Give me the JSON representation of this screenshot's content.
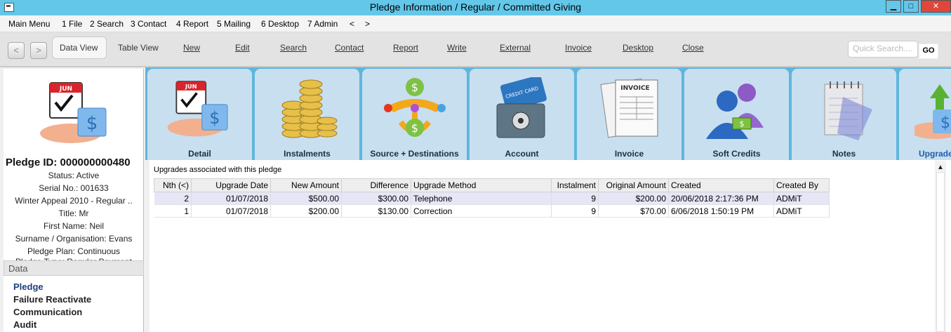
{
  "window": {
    "title": "Pledge Information / Regular / Committed Giving",
    "minimize": "▁",
    "maximize": "□",
    "close": "✕"
  },
  "menu": [
    "Main Menu",
    "1 File",
    "2 Search",
    "3 Contact",
    "4 Report",
    "5 Mailing",
    "6 Desktop",
    "7 Admin",
    "<",
    ">"
  ],
  "toolbar": {
    "back": "<",
    "forward": ">",
    "items": [
      "Data View",
      "Table View",
      "New",
      "Edit",
      "Search",
      "Contact",
      "Report",
      "Write",
      "External",
      "Invoice",
      "Desktop",
      "Close"
    ],
    "quick_search_placeholder": "Quick Search....",
    "go": "GO"
  },
  "record": {
    "pledge_id": "Pledge ID: 000000000480",
    "lines": [
      "Status: Active",
      "Serial No.: 001633",
      "Winter Appeal 2010 - Regular ..",
      "Title: Mr",
      "First Name: Neil",
      "Surname / Organisation: Evans",
      "Pledge Plan: Continuous",
      "Pledge Type: Regular Payment"
    ]
  },
  "data_panel": {
    "header": "Data",
    "links": [
      "Pledge",
      "Failure Reactivate",
      "Communication",
      "Audit"
    ]
  },
  "tabs": [
    "Detail",
    "Instalments",
    "Source + Destinations",
    "Account",
    "Invoice",
    "Soft Credits",
    "Notes",
    "Upgrades"
  ],
  "calendar_month": "JUN",
  "invoice_text": "INVOICE",
  "card_text": "CREDIT CARD",
  "upgrades": {
    "caption": "Upgrades associated with this pledge",
    "columns": [
      "Nth (<)",
      "Upgrade Date",
      "New Amount",
      "Difference",
      "Upgrade Method",
      "Instalment",
      "Original Amount",
      "Created",
      "Created By"
    ],
    "rows": [
      [
        "2",
        "01/07/2018",
        "$500.00",
        "$300.00",
        "Telephone",
        "9",
        "$200.00",
        "20/06/2018 2:17:36 PM",
        "ADMiT"
      ],
      [
        "1",
        "01/07/2018",
        "$200.00",
        "$130.00",
        "Correction",
        "9",
        "$70.00",
        "6/06/2018 1:50:19 PM",
        "ADMiT"
      ]
    ]
  },
  "colors": {
    "titlebar": "#63c7ea",
    "tabstrip": "#5fb6dc",
    "tab": "#c8dff0",
    "selected_row": "#e6e6f6",
    "link_active": "#1e3f7a"
  }
}
